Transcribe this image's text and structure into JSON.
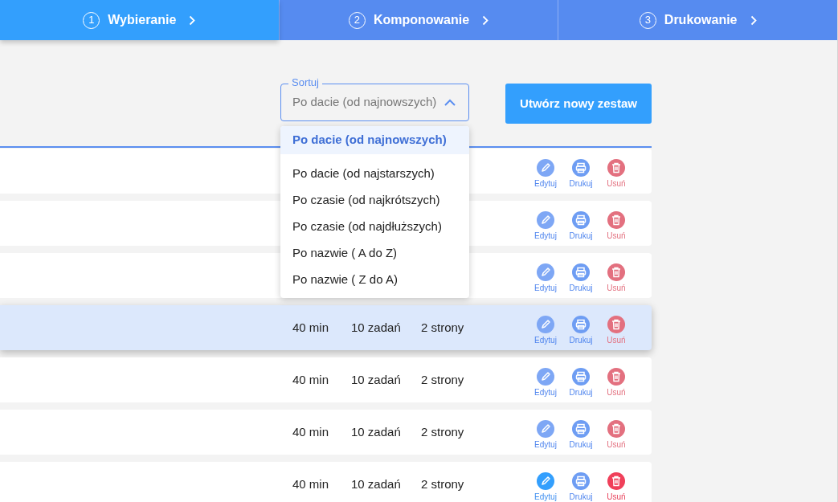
{
  "steps": [
    {
      "number": "1",
      "label": "Wybieranie",
      "selected": true
    },
    {
      "number": "2",
      "label": "Komponowanie",
      "selected": false
    },
    {
      "number": "3",
      "label": "Drukowanie",
      "selected": false
    }
  ],
  "sort": {
    "label": "Sortuj",
    "value": "Po dacie (od najnowszych)",
    "expanded": true,
    "options": [
      {
        "label": "Po dacie (od najnowszych)",
        "selected": true
      },
      {
        "label": "Po dacie (od najstarszych)",
        "selected": false
      },
      {
        "label": "Po czasie (od najkrótszych)",
        "selected": false
      },
      {
        "label": "Po czasie (od najdłuższych)",
        "selected": false
      },
      {
        "label": "Po nazwie ( A do Z)",
        "selected": false
      },
      {
        "label": "Po nazwie ( Z do A)",
        "selected": false
      }
    ]
  },
  "create_button": "Utwórz nowy zestaw",
  "rows": [
    {
      "highlighted": false,
      "actions_active": false,
      "actions": [
        "Edytuj",
        "Drukuj",
        "Usuń"
      ]
    },
    {
      "highlighted": false,
      "actions_active": false,
      "actions": [
        "Edytuj",
        "Drukuj",
        "Usuń"
      ]
    },
    {
      "highlighted": false,
      "actions_active": false,
      "actions": [
        "Edytuj",
        "Drukuj",
        "Usuń"
      ]
    },
    {
      "highlighted": true,
      "actions_active": false,
      "time": "40 min",
      "tasks": "10 zadań",
      "pages": "2 strony",
      "actions": [
        "Edytuj",
        "Drukuj",
        "Usuń"
      ]
    },
    {
      "highlighted": false,
      "actions_active": false,
      "time": "40 min",
      "tasks": "10 zadań",
      "pages": "2 strony",
      "actions": [
        "Edytuj",
        "Drukuj",
        "Usuń"
      ]
    },
    {
      "highlighted": false,
      "actions_active": false,
      "time": "40 min",
      "tasks": "10 zadań",
      "pages": "2 strony",
      "actions": [
        "Edytuj",
        "Drukuj",
        "Usuń"
      ]
    },
    {
      "highlighted": false,
      "actions_active": true,
      "time": "40 min",
      "tasks": "10 zadań",
      "pages": "2 strony",
      "actions": [
        "Edytuj",
        "Drukuj",
        "Usuń"
      ]
    }
  ]
}
